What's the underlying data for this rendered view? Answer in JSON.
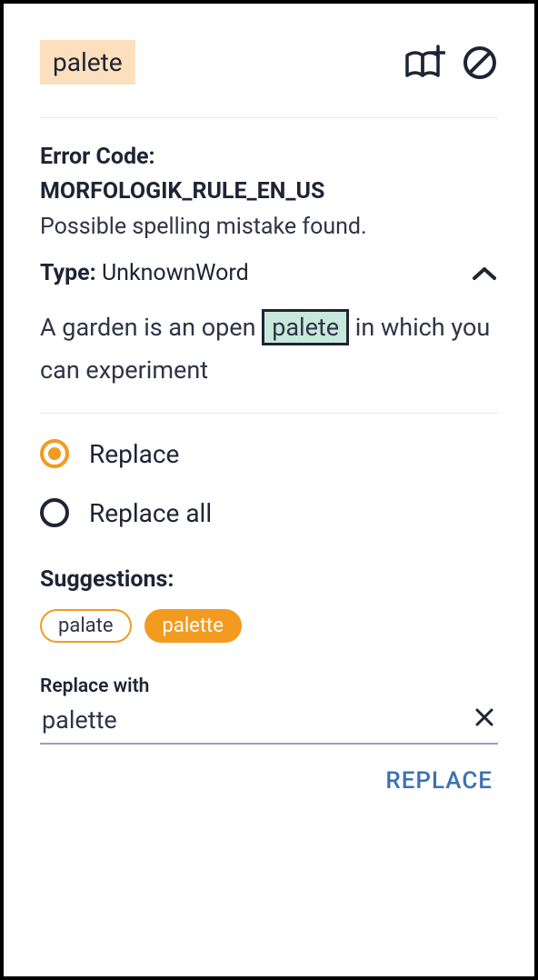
{
  "header": {
    "word": "palete"
  },
  "error": {
    "code_label": "Error Code:",
    "code_value": "MORFOLOGIK_RULE_EN_US",
    "description": "Possible spelling mistake found.",
    "type_label": "Type:",
    "type_value": "UnknownWord"
  },
  "context": {
    "before": "A garden is an open ",
    "highlight": "palete",
    "after": " in which you can experiment"
  },
  "options": {
    "replace": "Replace",
    "replace_all": "Replace all"
  },
  "suggestions": {
    "label": "Suggestions:",
    "items": [
      "palate",
      "palette"
    ],
    "selected_index": 1
  },
  "replace_with": {
    "label": "Replace with",
    "value": "palette"
  },
  "actions": {
    "replace": "REPLACE"
  }
}
